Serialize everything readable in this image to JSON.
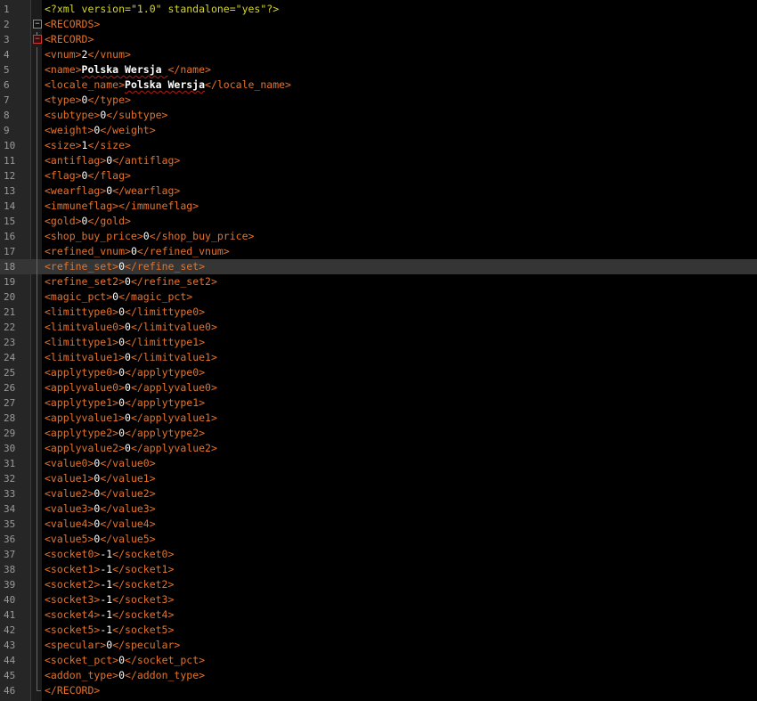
{
  "editor": {
    "declaration": {
      "open": "<?xml",
      "version_attr": " version=",
      "version_val": "\"1.0\"",
      "standalone_attr": " standalone=",
      "standalone_val": "\"yes\"",
      "close": "?>"
    },
    "current_line": 18,
    "lines": [
      {
        "n": "1",
        "kind": "decl"
      },
      {
        "n": "2",
        "kind": "open",
        "tag": "<RECORDS>"
      },
      {
        "n": "3",
        "kind": "open",
        "tag": "<RECORD>"
      },
      {
        "n": "4",
        "kind": "elem",
        "open": "<vnum>",
        "value": "2",
        "close": "</vnum>"
      },
      {
        "n": "5",
        "kind": "elem",
        "open": "<name>",
        "value": "Polska Wersja ",
        "close": "</name>",
        "bold": true
      },
      {
        "n": "6",
        "kind": "elem",
        "open": "<locale_name>",
        "value": "Polska Wersja",
        "close": "</locale_name>",
        "bold": true
      },
      {
        "n": "7",
        "kind": "elem",
        "open": "<type>",
        "value": "0",
        "close": "</type>"
      },
      {
        "n": "8",
        "kind": "elem",
        "open": "<subtype>",
        "value": "0",
        "close": "</subtype>"
      },
      {
        "n": "9",
        "kind": "elem",
        "open": "<weight>",
        "value": "0",
        "close": "</weight>"
      },
      {
        "n": "10",
        "kind": "elem",
        "open": "<size>",
        "value": "1",
        "close": "</size>"
      },
      {
        "n": "11",
        "kind": "elem",
        "open": "<antiflag>",
        "value": "0",
        "close": "</antiflag>"
      },
      {
        "n": "12",
        "kind": "elem",
        "open": "<flag>",
        "value": "0",
        "close": "</flag>"
      },
      {
        "n": "13",
        "kind": "elem",
        "open": "<wearflag>",
        "value": "0",
        "close": "</wearflag>"
      },
      {
        "n": "14",
        "kind": "elem",
        "open": "<immuneflag>",
        "value": "",
        "close": "</immuneflag>"
      },
      {
        "n": "15",
        "kind": "elem",
        "open": "<gold>",
        "value": "0",
        "close": "</gold>"
      },
      {
        "n": "16",
        "kind": "elem",
        "open": "<shop_buy_price>",
        "value": "0",
        "close": "</shop_buy_price>"
      },
      {
        "n": "17",
        "kind": "elem",
        "open": "<refined_vnum>",
        "value": "0",
        "close": "</refined_vnum>"
      },
      {
        "n": "18",
        "kind": "elem",
        "open": "<refine_set>",
        "value": "0",
        "close": "</refine_set>"
      },
      {
        "n": "19",
        "kind": "elem",
        "open": "<refine_set2>",
        "value": "0",
        "close": "</refine_set2>"
      },
      {
        "n": "20",
        "kind": "elem",
        "open": "<magic_pct>",
        "value": "0",
        "close": "</magic_pct>"
      },
      {
        "n": "21",
        "kind": "elem",
        "open": "<limittype0>",
        "value": "0",
        "close": "</limittype0>"
      },
      {
        "n": "22",
        "kind": "elem",
        "open": "<limitvalue0>",
        "value": "0",
        "close": "</limitvalue0>"
      },
      {
        "n": "23",
        "kind": "elem",
        "open": "<limittype1>",
        "value": "0",
        "close": "</limittype1>"
      },
      {
        "n": "24",
        "kind": "elem",
        "open": "<limitvalue1>",
        "value": "0",
        "close": "</limitvalue1>"
      },
      {
        "n": "25",
        "kind": "elem",
        "open": "<applytype0>",
        "value": "0",
        "close": "</applytype0>"
      },
      {
        "n": "26",
        "kind": "elem",
        "open": "<applyvalue0>",
        "value": "0",
        "close": "</applyvalue0>"
      },
      {
        "n": "27",
        "kind": "elem",
        "open": "<applytype1>",
        "value": "0",
        "close": "</applytype1>"
      },
      {
        "n": "28",
        "kind": "elem",
        "open": "<applyvalue1>",
        "value": "0",
        "close": "</applyvalue1>"
      },
      {
        "n": "29",
        "kind": "elem",
        "open": "<applytype2>",
        "value": "0",
        "close": "</applytype2>"
      },
      {
        "n": "30",
        "kind": "elem",
        "open": "<applyvalue2>",
        "value": "0",
        "close": "</applyvalue2>"
      },
      {
        "n": "31",
        "kind": "elem",
        "open": "<value0>",
        "value": "0",
        "close": "</value0>"
      },
      {
        "n": "32",
        "kind": "elem",
        "open": "<value1>",
        "value": "0",
        "close": "</value1>"
      },
      {
        "n": "33",
        "kind": "elem",
        "open": "<value2>",
        "value": "0",
        "close": "</value2>"
      },
      {
        "n": "34",
        "kind": "elem",
        "open": "<value3>",
        "value": "0",
        "close": "</value3>"
      },
      {
        "n": "35",
        "kind": "elem",
        "open": "<value4>",
        "value": "0",
        "close": "</value4>"
      },
      {
        "n": "36",
        "kind": "elem",
        "open": "<value5>",
        "value": "0",
        "close": "</value5>"
      },
      {
        "n": "37",
        "kind": "elem",
        "open": "<socket0>",
        "value": "-1",
        "close": "</socket0>"
      },
      {
        "n": "38",
        "kind": "elem",
        "open": "<socket1>",
        "value": "-1",
        "close": "</socket1>"
      },
      {
        "n": "39",
        "kind": "elem",
        "open": "<socket2>",
        "value": "-1",
        "close": "</socket2>"
      },
      {
        "n": "40",
        "kind": "elem",
        "open": "<socket3>",
        "value": "-1",
        "close": "</socket3>"
      },
      {
        "n": "41",
        "kind": "elem",
        "open": "<socket4>",
        "value": "-1",
        "close": "</socket4>"
      },
      {
        "n": "42",
        "kind": "elem",
        "open": "<socket5>",
        "value": "-1",
        "close": "</socket5>"
      },
      {
        "n": "43",
        "kind": "elem",
        "open": "<specular>",
        "value": "0",
        "close": "</specular>"
      },
      {
        "n": "44",
        "kind": "elem",
        "open": "<socket_pct>",
        "value": "0",
        "close": "</socket_pct>"
      },
      {
        "n": "45",
        "kind": "elem",
        "open": "<addon_type>",
        "value": "0",
        "close": "</addon_type>"
      },
      {
        "n": "46",
        "kind": "close",
        "tag": "</RECORD>"
      }
    ]
  },
  "colors": {
    "background": "#000000",
    "tag": "#e5722a",
    "value": "#ffffff",
    "declaration": "#d6d629",
    "line_number": "#9a9a9a",
    "current_line": "#353535",
    "fold_marker_active": "#d23a3a"
  },
  "icons": {
    "fold_records": "fold-collapse-icon",
    "fold_record": "fold-collapse-icon"
  }
}
